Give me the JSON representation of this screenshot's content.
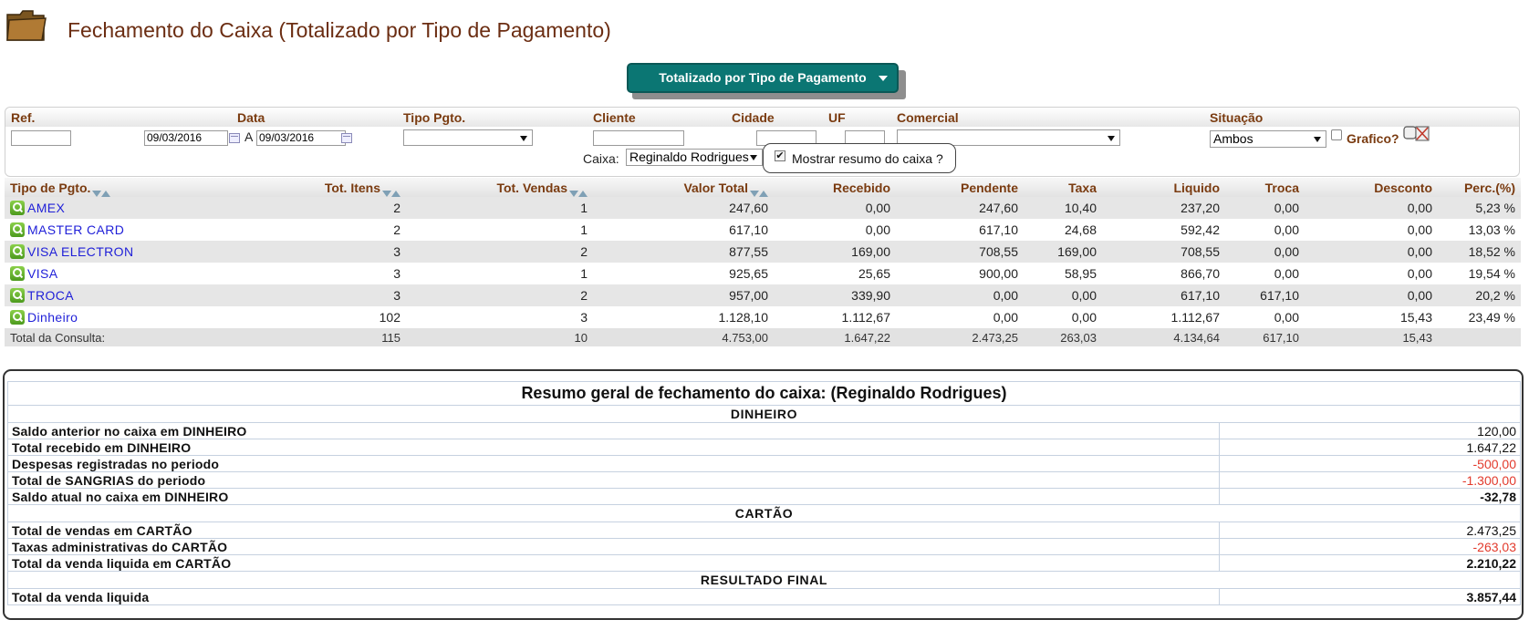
{
  "page": {
    "title": "Fechamento do Caixa (Totalizado por Tipo de Pagamento)"
  },
  "mode_selector": {
    "label": "Totalizado por Tipo de Pagamento"
  },
  "filters": {
    "labels": {
      "ref": "Ref.",
      "data": "Data",
      "tipo_pgto": "Tipo Pgto.",
      "cliente": "Cliente",
      "cidade": "Cidade",
      "uf": "UF",
      "comercial": "Comercial",
      "situacao": "Situação"
    },
    "ref_value": "",
    "date_from": "09/03/2016",
    "date_sep": "A",
    "date_to": "09/03/2016",
    "tipo_pgto_value": "",
    "cliente_value": "",
    "cidade_value": "",
    "uf_value": "",
    "comercial_value": "",
    "situacao_value": "Ambos",
    "grafico_label": "Grafico?",
    "caixa_label": "Caixa:",
    "caixa_value": "Reginaldo Rodrigues",
    "mostrar_resumo_label": "Mostrar resumo do caixa ?",
    "mostrar_resumo_checked": true
  },
  "results": {
    "columns": [
      "Tipo de Pgto.",
      "Tot. Itens",
      "Tot. Vendas",
      "Valor Total",
      "Recebido",
      "Pendente",
      "Taxa",
      "Liquido",
      "Troca",
      "Desconto",
      "Perc.(%)"
    ],
    "rows": [
      {
        "tipo": "AMEX",
        "itens": "2",
        "vendas": "1",
        "valor": "247,60",
        "recebido": "0,00",
        "pendente": "247,60",
        "taxa": "10,40",
        "liquido": "237,20",
        "troca": "0,00",
        "desconto": "0,00",
        "perc": "5,23 %"
      },
      {
        "tipo": "MASTER CARD",
        "itens": "2",
        "vendas": "1",
        "valor": "617,10",
        "recebido": "0,00",
        "pendente": "617,10",
        "taxa": "24,68",
        "liquido": "592,42",
        "troca": "0,00",
        "desconto": "0,00",
        "perc": "13,03 %"
      },
      {
        "tipo": "VISA ELECTRON",
        "itens": "3",
        "vendas": "2",
        "valor": "877,55",
        "recebido": "169,00",
        "pendente": "708,55",
        "taxa": "169,00",
        "liquido": "708,55",
        "troca": "0,00",
        "desconto": "0,00",
        "perc": "18,52 %"
      },
      {
        "tipo": "VISA",
        "itens": "3",
        "vendas": "1",
        "valor": "925,65",
        "recebido": "25,65",
        "pendente": "900,00",
        "taxa": "58,95",
        "liquido": "866,70",
        "troca": "0,00",
        "desconto": "0,00",
        "perc": "19,54 %"
      },
      {
        "tipo": "TROCA",
        "itens": "3",
        "vendas": "2",
        "valor": "957,00",
        "recebido": "339,90",
        "pendente": "0,00",
        "taxa": "0,00",
        "liquido": "617,10",
        "troca": "617,10",
        "desconto": "0,00",
        "perc": "20,2 %"
      },
      {
        "tipo": "Dinheiro",
        "itens": "102",
        "vendas": "3",
        "valor": "1.128,10",
        "recebido": "1.112,67",
        "pendente": "0,00",
        "taxa": "0,00",
        "liquido": "1.112,67",
        "troca": "0,00",
        "desconto": "15,43",
        "perc": "23,49 %"
      }
    ],
    "total": {
      "label": "Total da Consulta:",
      "itens": "115",
      "vendas": "10",
      "valor": "4.753,00",
      "recebido": "1.647,22",
      "pendente": "2.473,25",
      "taxa": "263,03",
      "liquido": "4.134,64",
      "troca": "617,10",
      "desconto": "15,43",
      "perc": ""
    }
  },
  "resumo": {
    "title": "Resumo geral de fechamento do caixa: (Reginaldo Rodrigues)",
    "sections": [
      {
        "heading": "DINHEIRO",
        "lines": [
          {
            "label": "Saldo anterior no caixa em DINHEIRO",
            "value": "120,00",
            "negative": false,
            "bold": false
          },
          {
            "label": "Total recebido em DINHEIRO",
            "value": "1.647,22",
            "negative": false,
            "bold": false
          },
          {
            "label": "Despesas registradas no periodo",
            "value": "-500,00",
            "negative": true,
            "bold": false
          },
          {
            "label": "Total de SANGRIAS do periodo",
            "value": "-1.300,00",
            "negative": true,
            "bold": false
          },
          {
            "label": "Saldo atual no caixa em DINHEIRO",
            "value": "-32,78",
            "negative": false,
            "bold": true
          }
        ]
      },
      {
        "heading": "CARTÃO",
        "lines": [
          {
            "label": "Total de vendas em CARTÃO",
            "value": "2.473,25",
            "negative": false,
            "bold": false
          },
          {
            "label": "Taxas administrativas do CARTÃO",
            "value": "-263,03",
            "negative": true,
            "bold": false
          },
          {
            "label": "Total da venda liquida em CARTÃO",
            "value": "2.210,22",
            "negative": false,
            "bold": true
          }
        ]
      },
      {
        "heading": "RESULTADO FINAL",
        "lines": [
          {
            "label": "Total da venda liquida",
            "value": "3.857,44",
            "negative": false,
            "bold": true
          }
        ]
      }
    ]
  },
  "colors": {
    "title": "#6b2d12",
    "accent": "#0b7673",
    "link": "#1f1fd8",
    "negative": "#e23a2c",
    "label": "#7a3b10"
  }
}
